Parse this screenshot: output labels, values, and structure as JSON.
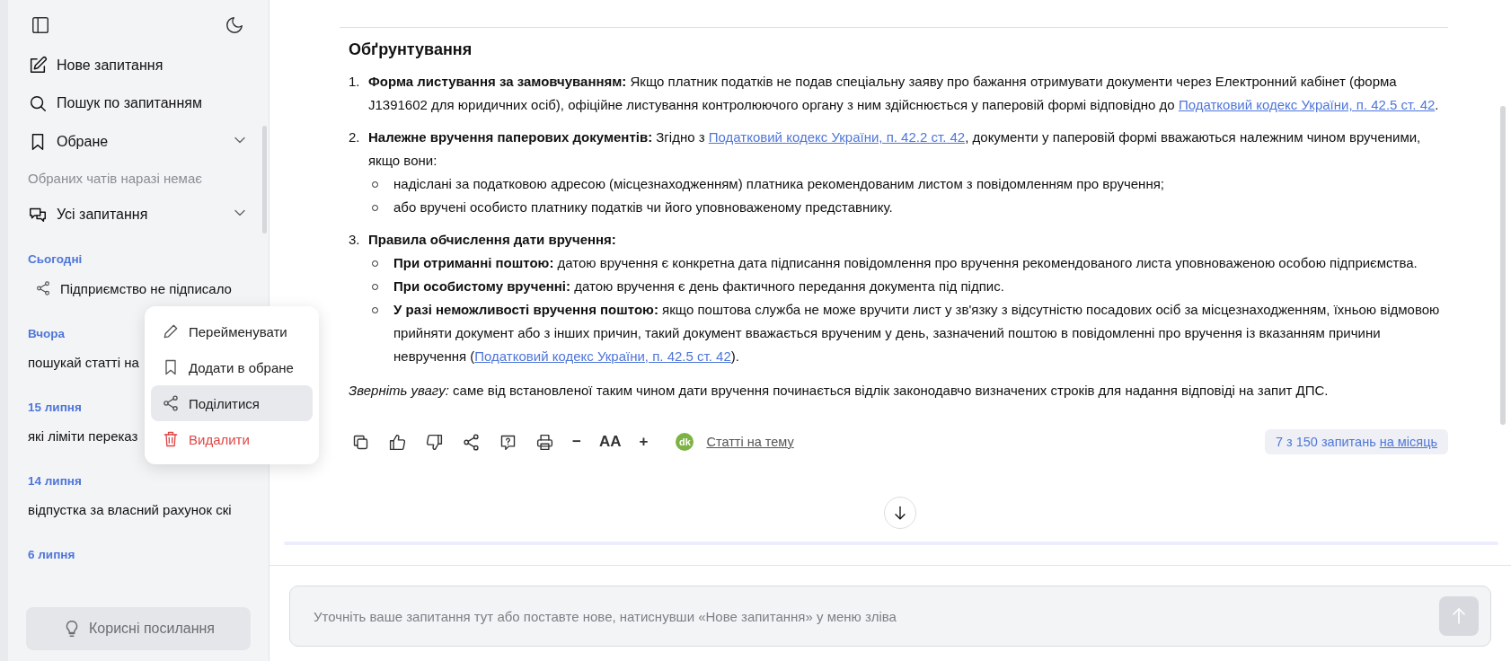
{
  "sidebar": {
    "nav": [
      {
        "kind": "new",
        "label": "Нове запитання"
      },
      {
        "kind": "search",
        "label": "Пошук по запитанням"
      },
      {
        "kind": "favorites",
        "label": "Обране",
        "expanded": true
      },
      {
        "kind": "note",
        "label": "Обраних чатів наразі немає"
      },
      {
        "kind": "all",
        "label": "Усі запитання",
        "expanded": true
      }
    ],
    "history": [
      {
        "date": "Сьогодні",
        "items": [
          {
            "title": "Підприємство не підписало",
            "shared": true
          }
        ]
      },
      {
        "date": "Вчора",
        "items": [
          {
            "title": "пошукай статті на",
            "shared": false
          }
        ]
      },
      {
        "date": "15 липня",
        "items": [
          {
            "title": "які ліміти переказ",
            "shared": false
          }
        ]
      },
      {
        "date": "14 липня",
        "items": [
          {
            "title": "відпустка за власний рахунок скі",
            "shared": false
          }
        ]
      },
      {
        "date": "6 липня"
      }
    ],
    "footer_button": "Корисні посилання"
  },
  "context_menu": [
    {
      "kind": "rename",
      "label": "Перейменувати",
      "selected": false
    },
    {
      "kind": "bookmark",
      "label": "Додати в обране",
      "selected": false
    },
    {
      "kind": "share",
      "label": "Поділитися",
      "selected": true
    },
    {
      "kind": "delete",
      "label": "Видалити",
      "selected": false
    }
  ],
  "answer": {
    "heading": "Обґрунтування",
    "blocks": [
      {
        "kind": "ol",
        "marker": "1.",
        "parts": [
          {
            "kind": "bold",
            "s": "Форма листування за замовчуванням:"
          },
          {
            "kind": "plain",
            "s": " Якщо платник податків не подав спеціальну заяву про бажання отримувати документи через Електронний кабінет (форма J1391602 для юридичних осіб), офіційне листування контролюючого органу з ним здійснюється у паперовій формі відповідно до "
          },
          {
            "kind": "link",
            "s": "Податковий кодекс України, п. 42.5 ст. 42"
          },
          {
            "kind": "plain",
            "s": "."
          }
        ]
      },
      {
        "kind": "ol",
        "marker": "2.",
        "parts": [
          {
            "kind": "bold",
            "s": "Належне вручення паперових документів:"
          },
          {
            "kind": "plain",
            "s": " Згідно з "
          },
          {
            "kind": "link",
            "s": "Податковий кодекс України, п. 42.2 ст. 42"
          },
          {
            "kind": "plain",
            "s": ", документи у паперовій формі вважаються належним чином врученими, якщо вони:"
          }
        ]
      },
      {
        "kind": "ul",
        "parts": [
          {
            "kind": "plain",
            "s": "надіслані за податковою адресою (місцезнаходженням) платника рекомендованим листом з повідомленням про вручення;"
          }
        ]
      },
      {
        "kind": "ul",
        "parts": [
          {
            "kind": "plain",
            "s": "або вручені особисто платнику податків чи його уповноваженому представнику."
          }
        ]
      },
      {
        "kind": "ol",
        "marker": "3.",
        "parts": [
          {
            "kind": "bold",
            "s": "Правила обчислення дати вручення:"
          }
        ]
      },
      {
        "kind": "ul",
        "parts": [
          {
            "kind": "bold",
            "s": "При отриманні поштою:"
          },
          {
            "kind": "plain",
            "s": " датою вручення є конкретна дата підписання повідомлення про вручення рекомендованого листа уповноваженою особою підприємства."
          }
        ]
      },
      {
        "kind": "ul",
        "parts": [
          {
            "kind": "bold",
            "s": "При особистому врученні:"
          },
          {
            "kind": "plain",
            "s": " датою вручення є день фактичного передання документа під підпис."
          }
        ]
      },
      {
        "kind": "ul",
        "parts": [
          {
            "kind": "bold",
            "s": "У разі неможливості вручення поштою:"
          },
          {
            "kind": "plain",
            "s": " якщо поштова служба не може вручити лист у зв'язку з відсутністю посадових осіб за місцезнаходженням, їхньою відмовою прийняти документ або з інших причин, такий документ вважається врученим у день, зазначений поштою в повідомленні про вручення із вказанням причини невручення ("
          },
          {
            "kind": "link",
            "s": "Податковий кодекс України, п. 42.5 ст. 42"
          },
          {
            "kind": "plain",
            "s": ")."
          }
        ]
      },
      {
        "kind": "p",
        "parts": [
          {
            "kind": "italic",
            "s": "Зверніть увагу:"
          },
          {
            "kind": "plain",
            "s": " саме від встановленої таким чином дати вручення починається відлік законодавчо визначених строків для надання відповіді на запит ДПС."
          }
        ]
      }
    ]
  },
  "toolbar": {
    "actions": [
      {
        "kind": "copy"
      },
      {
        "kind": "like"
      },
      {
        "kind": "dislike"
      },
      {
        "kind": "share"
      },
      {
        "kind": "question"
      },
      {
        "kind": "print"
      },
      {
        "kind": "minus",
        "label": "−"
      },
      {
        "kind": "font",
        "label": "AA"
      },
      {
        "kind": "plus",
        "label": "+"
      }
    ],
    "related_badge": "dk",
    "related_link": "Статті на тему",
    "quota": {
      "text": "7 з 150 запитань",
      "link": "на місяць"
    }
  },
  "composer": {
    "placeholder": "Уточніть ваше запитання тут або поставте нове, натиснувши «Нове запитання» у меню зліва"
  }
}
